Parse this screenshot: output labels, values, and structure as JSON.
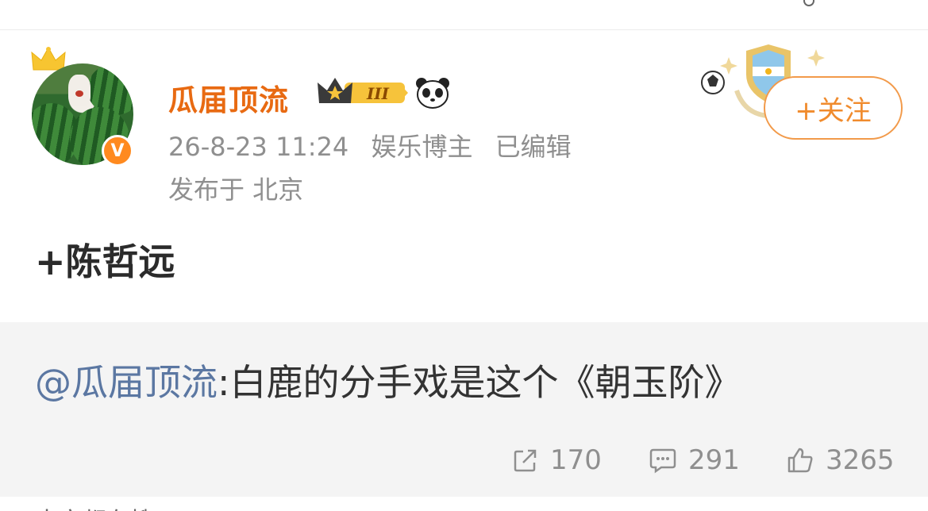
{
  "post": {
    "username": "瓜届顶流",
    "rank": "III",
    "timestamp": "26-8-23 11:24",
    "category": "娱乐博主",
    "edited": "已编辑",
    "location": "发布于 北京",
    "follow_label": "+关注",
    "text": "+陈哲远"
  },
  "repost": {
    "mention": "@瓜届顶流",
    "text": ":白鹿的分手戏是这个《朝玉阶》",
    "share_count": "170",
    "comment_count": "291",
    "like_count": "3265"
  },
  "bottom": {
    "partial_text": "大家都在搜"
  },
  "colors": {
    "username": "#e86a12",
    "mention": "#5b77a2",
    "follow": "#f08b2d",
    "repost_bg": "#f4f4f4"
  },
  "icons": [
    "crown-icon",
    "verified-v-icon",
    "rank-badge-icon",
    "panda-icon",
    "football-icon",
    "shield-icon",
    "share-icon",
    "comment-icon",
    "like-icon"
  ]
}
